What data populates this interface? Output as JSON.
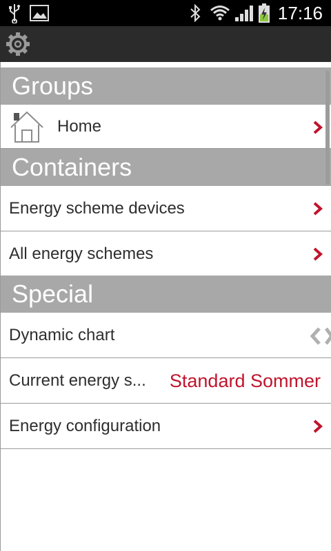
{
  "status_bar": {
    "time": "17:16",
    "icons": [
      "usb-icon",
      "image-icon",
      "bluetooth-icon",
      "wifi-icon",
      "signal-icon",
      "battery-charging-icon"
    ]
  },
  "action_bar": {
    "settings_icon": "gear-icon"
  },
  "sections": {
    "groups": {
      "title": "Groups",
      "items": [
        {
          "label": "Home",
          "icon": "home-icon"
        }
      ]
    },
    "containers": {
      "title": "Containers",
      "items": [
        {
          "label": "Energy scheme devices"
        },
        {
          "label": "All energy schemes"
        }
      ]
    },
    "special": {
      "title": "Special",
      "items": [
        {
          "label": "Dynamic chart",
          "icon": "code-brackets-icon"
        },
        {
          "label": "Current energy s...",
          "value": "Standard Sommer"
        },
        {
          "label": "Energy configuration"
        }
      ]
    }
  },
  "colors": {
    "header_bg": "#a8a8a8",
    "accent": "#c0142c",
    "action_bar_bg": "#2b2b2b"
  }
}
